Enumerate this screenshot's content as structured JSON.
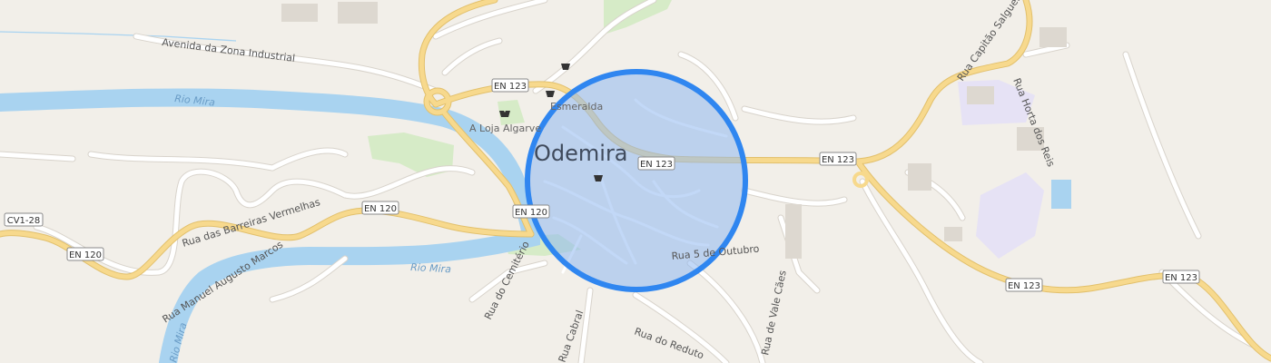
{
  "map": {
    "place_label": "Odemira",
    "colors": {
      "background": "#f2efe9",
      "river": "#a9d3f0",
      "major_road": "#f7d98d",
      "major_road_casing": "#e2c06c",
      "minor_road": "#ffffff",
      "minor_road_casing": "#d8d3cb",
      "park": "#d6ebc7",
      "landuse_purple": "#e6e2f5",
      "marker_fill": "#8fb8f0",
      "marker_stroke": "#2f86f0"
    },
    "road_shields": [
      {
        "id": "en123-nw",
        "text": "EN 123"
      },
      {
        "id": "en123-center",
        "text": "EN 123"
      },
      {
        "id": "en123-east",
        "text": "EN 123"
      },
      {
        "id": "en123-se",
        "text": "EN 123"
      },
      {
        "id": "en123-far-east",
        "text": "EN 123"
      },
      {
        "id": "en120-center",
        "text": "EN 120"
      },
      {
        "id": "en120-west",
        "text": "EN 120"
      },
      {
        "id": "en120-left",
        "text": "EN 120"
      },
      {
        "id": "cv128",
        "text": "CV1-28"
      }
    ],
    "street_labels": {
      "av_zona_industrial": "Avenida da Zona Industrial",
      "rua_barreiras": "Rua das Barreiras Vermelhas",
      "rua_manuel": "Rua Manuel Augusto Marcos",
      "rua_cemiterio": "Rua do Cemitério",
      "rua_cabral": "Rua Cabral",
      "rua_reduto": "Rua do Reduto",
      "rua_5_outubro": "Rua 5 de Outubro",
      "rua_vale_caes": "Rua de Vale Cães",
      "rua_horta": "Rua Horta dos Reis",
      "rua_capitao": "Rua Capitão Salgueiro",
      "rio_mira_1": "Rio Mira",
      "rio_mira_2": "Rio Mira",
      "rio_mira_3": "Rio Mira"
    },
    "pois": {
      "esmeralda": "Esmeralda",
      "loja_algarve": "A Loja Algarve"
    },
    "icons": [
      "shopping-basket-icon",
      "clothes-shop-icon"
    ]
  }
}
